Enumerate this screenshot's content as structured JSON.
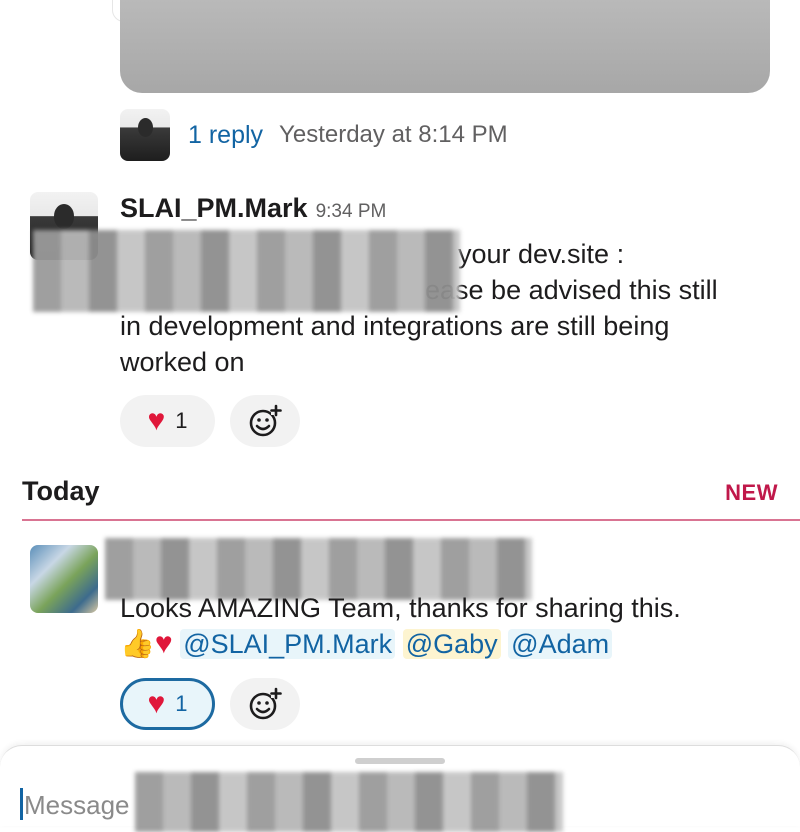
{
  "thread": {
    "replies_label": "1 reply",
    "last_reply_time": "Yesterday at 8:14 PM"
  },
  "message1": {
    "sender": "SLAI_PM.Mark",
    "time": "9:34 PM",
    "text_line1": "your dev.site :",
    "text_line2": "ease be advised this still",
    "text_line3": "in development and integrations are still being",
    "text_line4": "worked on",
    "reaction_emoji": "heart",
    "reaction_count": "1"
  },
  "divider": {
    "label": "Today",
    "new_label": "NEW"
  },
  "message2": {
    "text": "Looks AMAZING Team, thanks for sharing this.",
    "mentions": [
      "@SLAI_PM.Mark",
      "@Gaby",
      "@Adam"
    ],
    "reaction_count": "1"
  },
  "composer": {
    "placeholder": "Message"
  },
  "icons": {
    "add_reaction": "add-reaction-icon",
    "heart": "heart-icon",
    "thumbs_up": "thumbs-up-icon"
  },
  "colors": {
    "link": "#1264a3",
    "new_divider": "#c0184a",
    "heart": "#e0173a"
  }
}
